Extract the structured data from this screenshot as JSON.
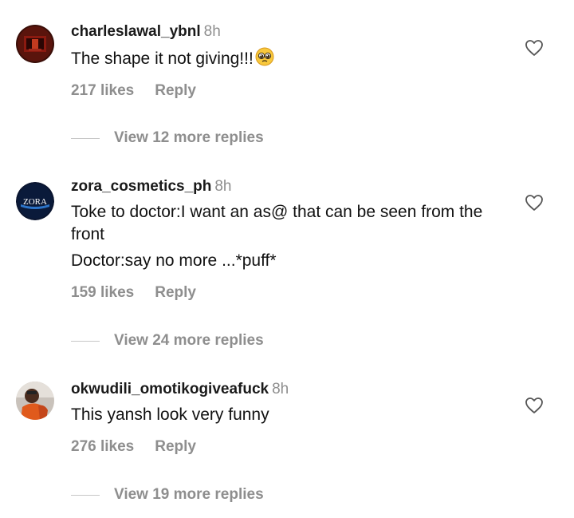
{
  "comments": [
    {
      "username": "charleslawal_ybnl",
      "time": "8h",
      "lines": [
        "The shape it not giving!!!"
      ],
      "emoji": "pleading-face-emoji",
      "likes": "217 likes",
      "reply_label": "Reply",
      "view_replies": "View 12 more replies",
      "avatar": "avatar-photo-red"
    },
    {
      "username": "zora_cosmetics_ph",
      "time": "8h",
      "lines": [
        "Toke to doctor:I want an as@ that can be seen from the front",
        "Doctor:say no more ...*puff*"
      ],
      "likes": "159 likes",
      "reply_label": "Reply",
      "view_replies": "View 24 more replies",
      "avatar": "zora-logo",
      "avatar_text": "ZORA"
    },
    {
      "username": "okwudili_omotikogiveafuck",
      "time": "8h",
      "lines": [
        "This yansh look very funny"
      ],
      "likes": "276 likes",
      "reply_label": "Reply",
      "view_replies": "View 19 more replies",
      "avatar": "avatar-photo-orange"
    }
  ],
  "icons": {
    "like": "heart-outline-icon"
  },
  "colors": {
    "text": "#111111",
    "muted": "#8e8e8e",
    "divider": "#c7c7c7"
  }
}
